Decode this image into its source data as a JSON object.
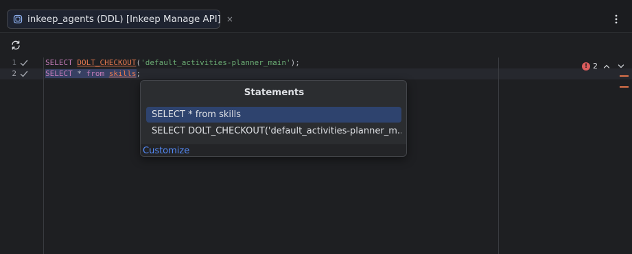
{
  "tab": {
    "title": "inkeep_agents (DDL) [Inkeep Manage API]",
    "close_glyph": "×",
    "icon": "database-console-icon"
  },
  "window": {
    "more_glyph": "⋮"
  },
  "toolbar": {
    "refresh_icon": "refresh-icon"
  },
  "editor": {
    "lines": [
      {
        "number": "1",
        "status_icon": "check-icon",
        "tokens": {
          "kw": "SELECT",
          "fn": "DOLT_CHECKOUT",
          "open": "(",
          "str": "'default_activities-planner_main'",
          "close": ");"
        }
      },
      {
        "number": "2",
        "status_icon": "check-icon",
        "tokens": {
          "kw": "SELECT",
          "star": "*",
          "from": "from",
          "table": "skills",
          "semi": ";"
        }
      }
    ],
    "problems": {
      "count": "2",
      "icon": "error-icon"
    }
  },
  "popup": {
    "title": "Statements",
    "items": [
      {
        "label": "SELECT * from skills",
        "selected": true
      },
      {
        "label": "SELECT DOLT_CHECKOUT('default_activities-planner_m...",
        "selected": false
      }
    ],
    "footer_link": "Customize"
  },
  "colors": {
    "background": "#1e1f22",
    "selection": "#2e436e",
    "link": "#548af7",
    "error": "#db5c5c",
    "keyword": "#cf8e6d",
    "string": "#6aab73"
  }
}
